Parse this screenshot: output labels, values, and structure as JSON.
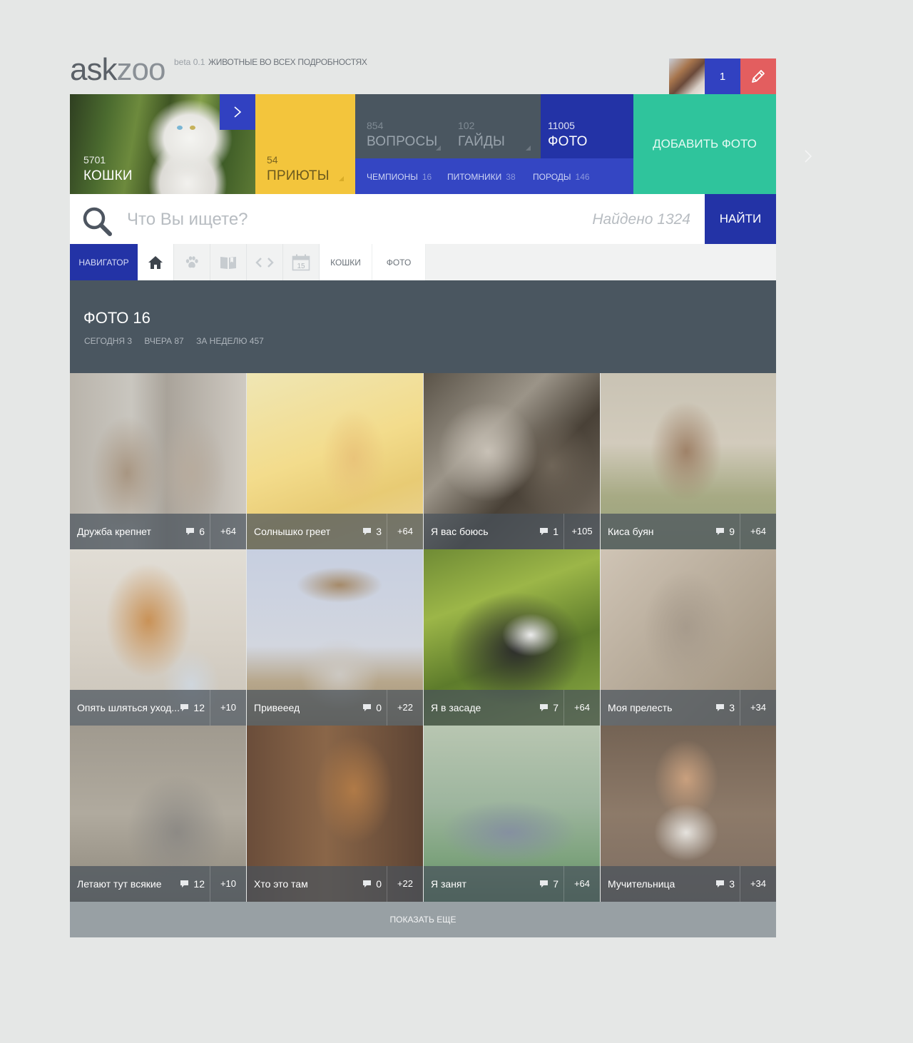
{
  "header": {
    "logo_ask": "ask",
    "logo_zoo": "zoo",
    "beta": "beta 0.1",
    "tagline": "ЖИВОТНЫЕ ВО ВСЕХ ПОДРОБНОСТЯХ",
    "user_count": "1"
  },
  "tiles": {
    "cats": {
      "count": "5701",
      "label": "КОШКИ"
    },
    "shelters": {
      "count": "54",
      "label": "ПРИЮТЫ"
    },
    "questions": {
      "count": "854",
      "label": "ВОПРОСЫ"
    },
    "guides": {
      "count": "102",
      "label": "ГАЙДЫ"
    },
    "photos": {
      "count": "11005",
      "label": "ФОТО"
    },
    "sub": [
      {
        "label": "ЧЕМПИОНЫ",
        "count": "16"
      },
      {
        "label": "ПИТОМНИКИ",
        "count": "38"
      },
      {
        "label": "ПОРОДЫ",
        "count": "146"
      }
    ],
    "add_photo": "ДОБАВИТЬ ФОТО"
  },
  "search": {
    "placeholder": "Что Вы ищете?",
    "found": "Найдено 1324",
    "button": "НАЙТИ"
  },
  "navigator": {
    "label": "НАВИГАТОР",
    "calendar_day": "15",
    "crumbs": [
      "КОШКИ",
      "ФОТО"
    ]
  },
  "section": {
    "title": "ФОТО",
    "count": "16",
    "stats": [
      "СЕГОДНЯ 3",
      "ВЧЕРА 87",
      "ЗА НЕДЕЛЮ 457"
    ]
  },
  "photos": [
    {
      "title": "Дружба крепнет",
      "comments": "6",
      "score": "+64"
    },
    {
      "title": "Солнышко греет",
      "comments": "3",
      "score": "+64"
    },
    {
      "title": "Я вас боюсь",
      "comments": "1",
      "score": "+105"
    },
    {
      "title": "Киса буян",
      "comments": "9",
      "score": "+64"
    },
    {
      "title": "Опять шляться уход...",
      "comments": "12",
      "score": "+10"
    },
    {
      "title": "Привееед",
      "comments": "0",
      "score": "+22"
    },
    {
      "title": "Я в засаде",
      "comments": "7",
      "score": "+64"
    },
    {
      "title": "Моя прелесть",
      "comments": "3",
      "score": "+34"
    },
    {
      "title": "Летают тут всякие",
      "comments": "12",
      "score": "+10"
    },
    {
      "title": "Хто это там",
      "comments": "0",
      "score": "+22"
    },
    {
      "title": "Я занят",
      "comments": "7",
      "score": "+64"
    },
    {
      "title": "Мучительница",
      "comments": "3",
      "score": "+34"
    }
  ],
  "show_more": "ПОКАЗАТЬ ЕЩЕ",
  "colors": {
    "blue": "#3141c1",
    "dark_blue": "#2333a6",
    "yellow": "#f3c53c",
    "slate": "#4a5660",
    "green": "#2fc49c",
    "red": "#e35e5f"
  }
}
